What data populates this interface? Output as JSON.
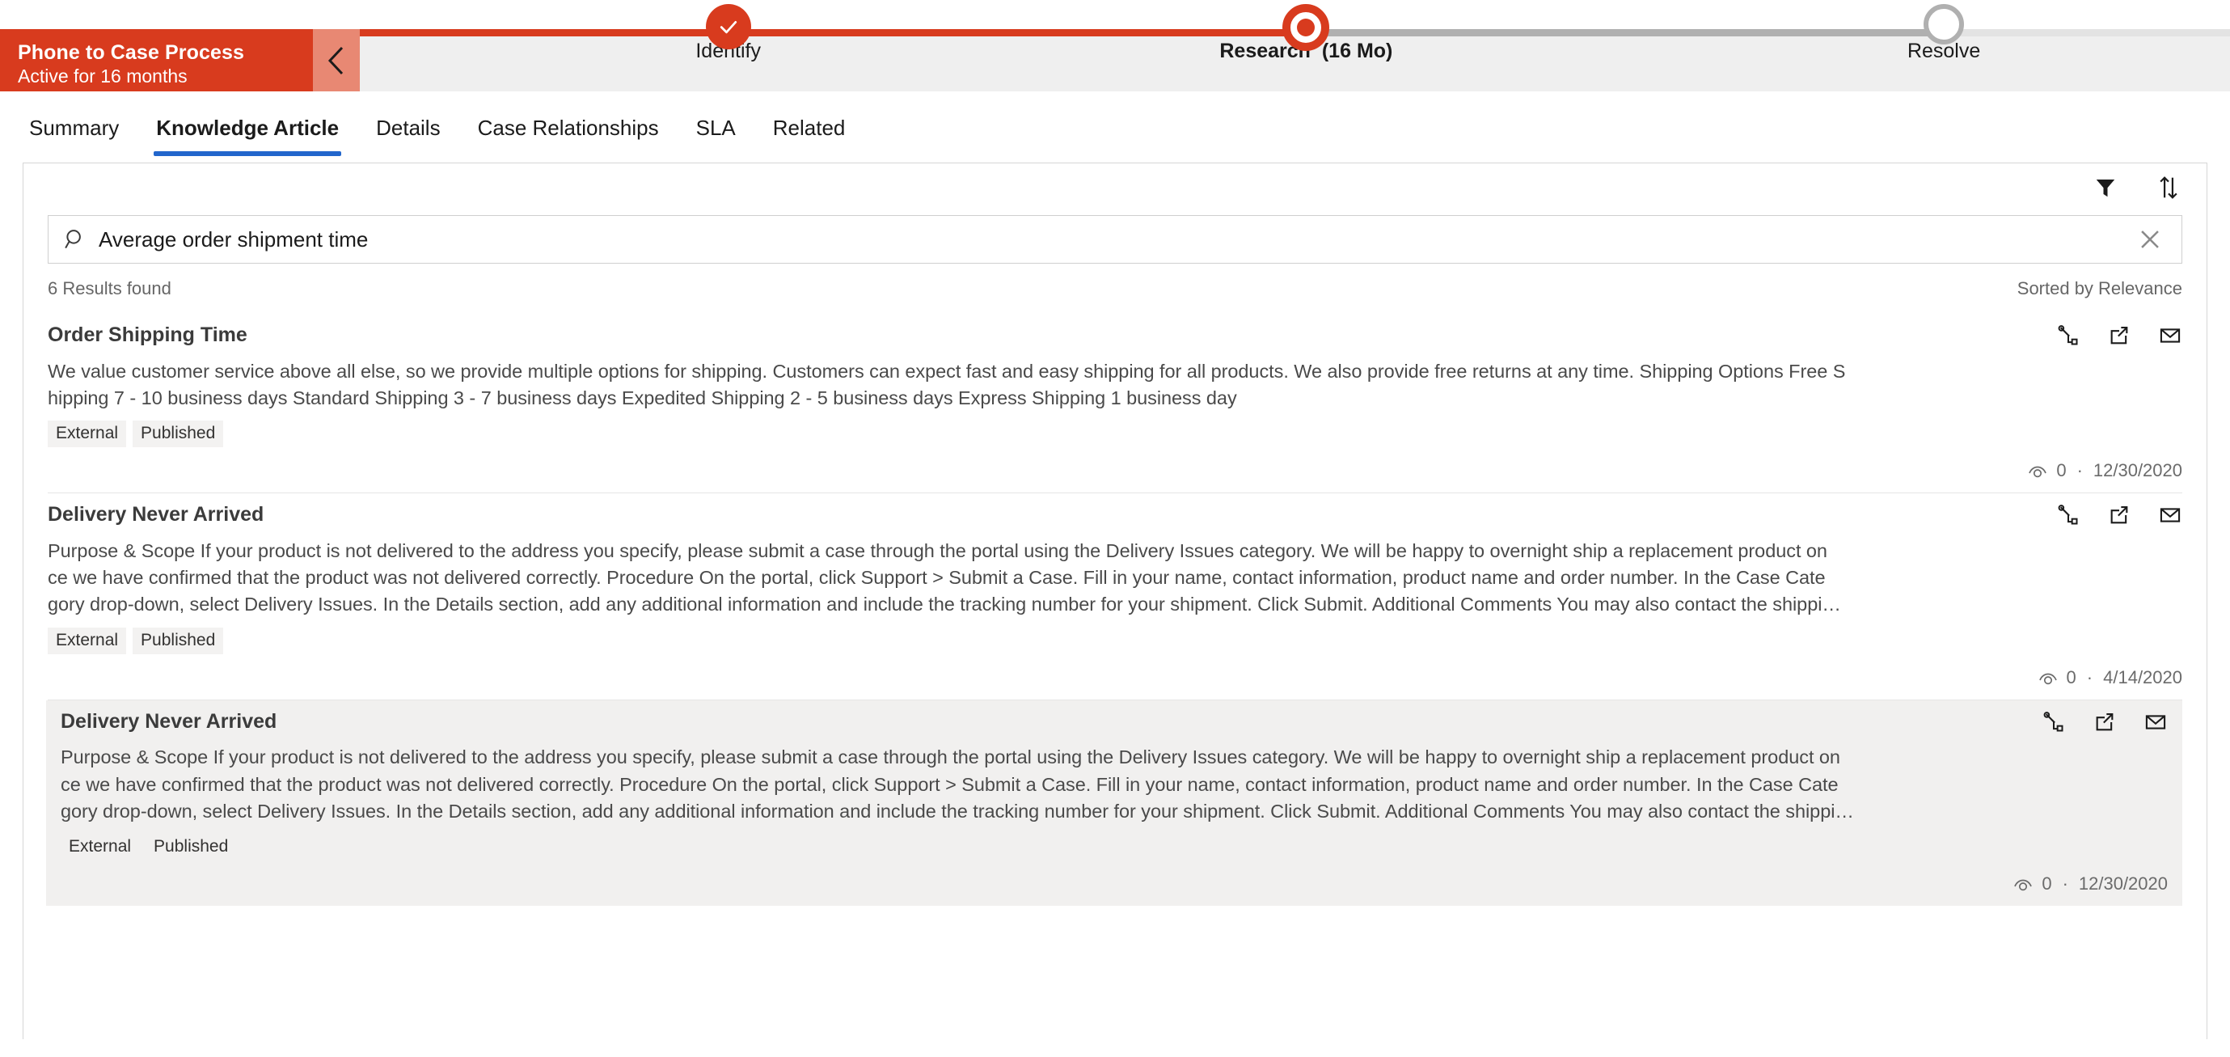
{
  "bpf": {
    "title": "Phone to Case Process",
    "subtitle": "Active for 16 months",
    "collapse_icon": "chevron-left-icon",
    "stages": [
      {
        "label": "Identify",
        "duration": "",
        "state": "complete"
      },
      {
        "label": "Research",
        "duration": "(16 Mo)",
        "state": "current"
      },
      {
        "label": "Resolve",
        "duration": "",
        "state": "future"
      }
    ],
    "colors": {
      "accent": "#d83b1e",
      "title_bg": "#d83b1e",
      "collapse_bg": "#e88873",
      "rail_bg": "#efefef",
      "future": "#b0b0b0"
    }
  },
  "tabs": [
    {
      "label": "Summary",
      "active": false
    },
    {
      "label": "Knowledge Article",
      "active": true
    },
    {
      "label": "Details",
      "active": false
    },
    {
      "label": "Case Relationships",
      "active": false
    },
    {
      "label": "SLA",
      "active": false
    },
    {
      "label": "Related",
      "active": false
    }
  ],
  "tab_accent": "#2266cc",
  "toolbar": {
    "filter_icon": "filter-icon",
    "sort_icon": "sort-arrows-icon"
  },
  "search": {
    "value": "Average order shipment time",
    "placeholder": "Search Knowledge Articles",
    "icon": "search-icon",
    "clear_icon": "close-icon"
  },
  "meta": {
    "results_count": "6 Results found",
    "sort_label": "Sorted by Relevance"
  },
  "article_actions": {
    "link_icon": "link-article-icon",
    "popout_icon": "open-in-new-window-icon",
    "email_icon": "email-icon"
  },
  "view_icon": "views-eye-icon",
  "separator": "·",
  "articles": [
    {
      "title": "Order Shipping Time",
      "lines": [
        "We value customer service above all else, so we provide multiple options for shipping. Customers can expect fast and easy shipping for all products. We also provide free returns at any time. Shipping Options Free S",
        "hipping 7 - 10 business days Standard Shipping 3 - 7 business days Expedited Shipping 2 - 5 business days Express Shipping 1 business day"
      ],
      "badges": [
        "External",
        "Published"
      ],
      "views": "0",
      "date": "12/30/2020",
      "hover": false
    },
    {
      "title": "Delivery Never Arrived",
      "lines": [
        "Purpose & Scope If your product is not delivered to the address you specify, please submit a case through the portal using the Delivery Issues category. We will be happy to overnight ship a replacement product on",
        "ce we have confirmed that the product was not delivered correctly. Procedure On the portal, click Support > Submit a Case. Fill in your name, contact information, product name and order number. In the Case Cate",
        "gory drop-down, select Delivery Issues. In the Details section, add any additional information and include the tracking number for your shipment. Click Submit. Additional Comments You may also contact the shippi…"
      ],
      "badges": [
        "External",
        "Published"
      ],
      "views": "0",
      "date": "4/14/2020",
      "hover": false
    },
    {
      "title": "Delivery Never Arrived",
      "lines": [
        "Purpose & Scope If your product is not delivered to the address you specify, please submit a case through the portal using the Delivery Issues category. We will be happy to overnight ship a replacement product on",
        "ce we have confirmed that the product was not delivered correctly. Procedure On the portal, click Support > Submit a Case. Fill in your name, contact information, product name and order number. In the Case Cate",
        "gory drop-down, select Delivery Issues. In the Details section, add any additional information and include the tracking number for your shipment. Click Submit. Additional Comments You may also contact the shippi…"
      ],
      "badges": [
        "External",
        "Published"
      ],
      "views": "0",
      "date": "12/30/2020",
      "hover": true
    }
  ]
}
